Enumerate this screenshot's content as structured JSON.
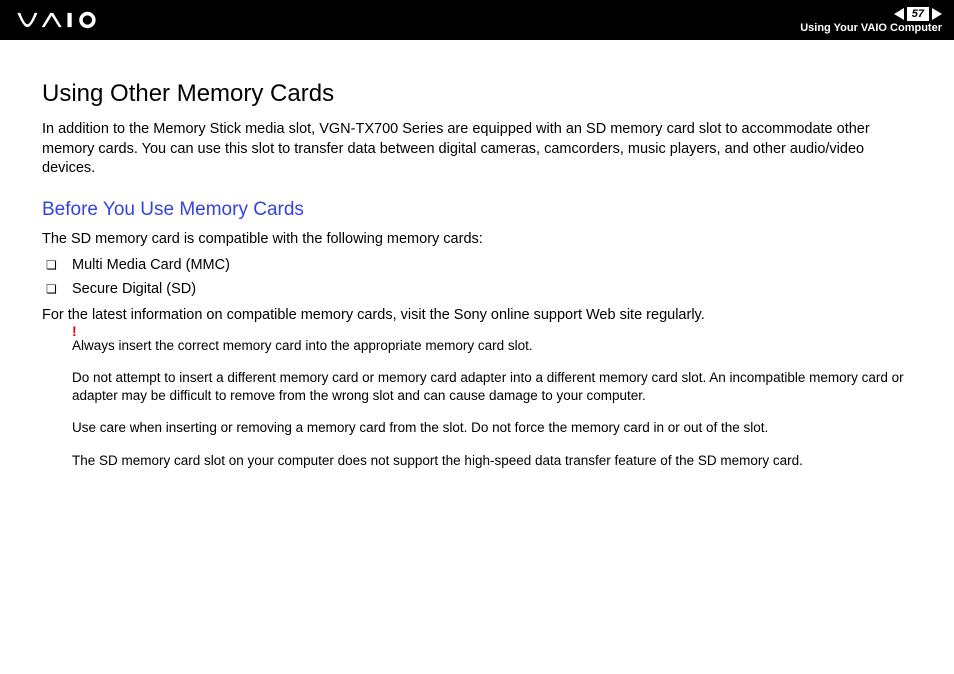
{
  "header": {
    "page_number": "57",
    "section": "Using Your VAIO Computer"
  },
  "title": "Using Other Memory Cards",
  "intro": "In addition to the Memory Stick media slot, VGN-TX700 Series are equipped with an SD memory card slot to accommodate other memory cards. You can use this slot to transfer data between digital cameras, camcorders, music players, and other audio/video devices.",
  "subheading": "Before You Use Memory Cards",
  "compat_intro": "The SD memory card is compatible with the following memory cards:",
  "bullets": {
    "0": "Multi Media Card (MMC)",
    "1": "Secure Digital (SD)"
  },
  "compat_note": "For the latest information on compatible memory cards, visit the Sony online support Web site regularly.",
  "bang": "!",
  "warnings": {
    "0": "Always insert the correct memory card into the appropriate memory card slot.",
    "1": "Do not attempt to insert a different memory card or memory card adapter into a different memory card slot. An incompatible memory card or adapter may be difficult to remove from the wrong slot and can cause damage to your computer.",
    "2": "Use care when inserting or removing a memory card from the slot. Do not force the memory card in or out of the slot.",
    "3": "The SD memory card slot on your computer does not support the high-speed data transfer feature of the SD memory card."
  }
}
